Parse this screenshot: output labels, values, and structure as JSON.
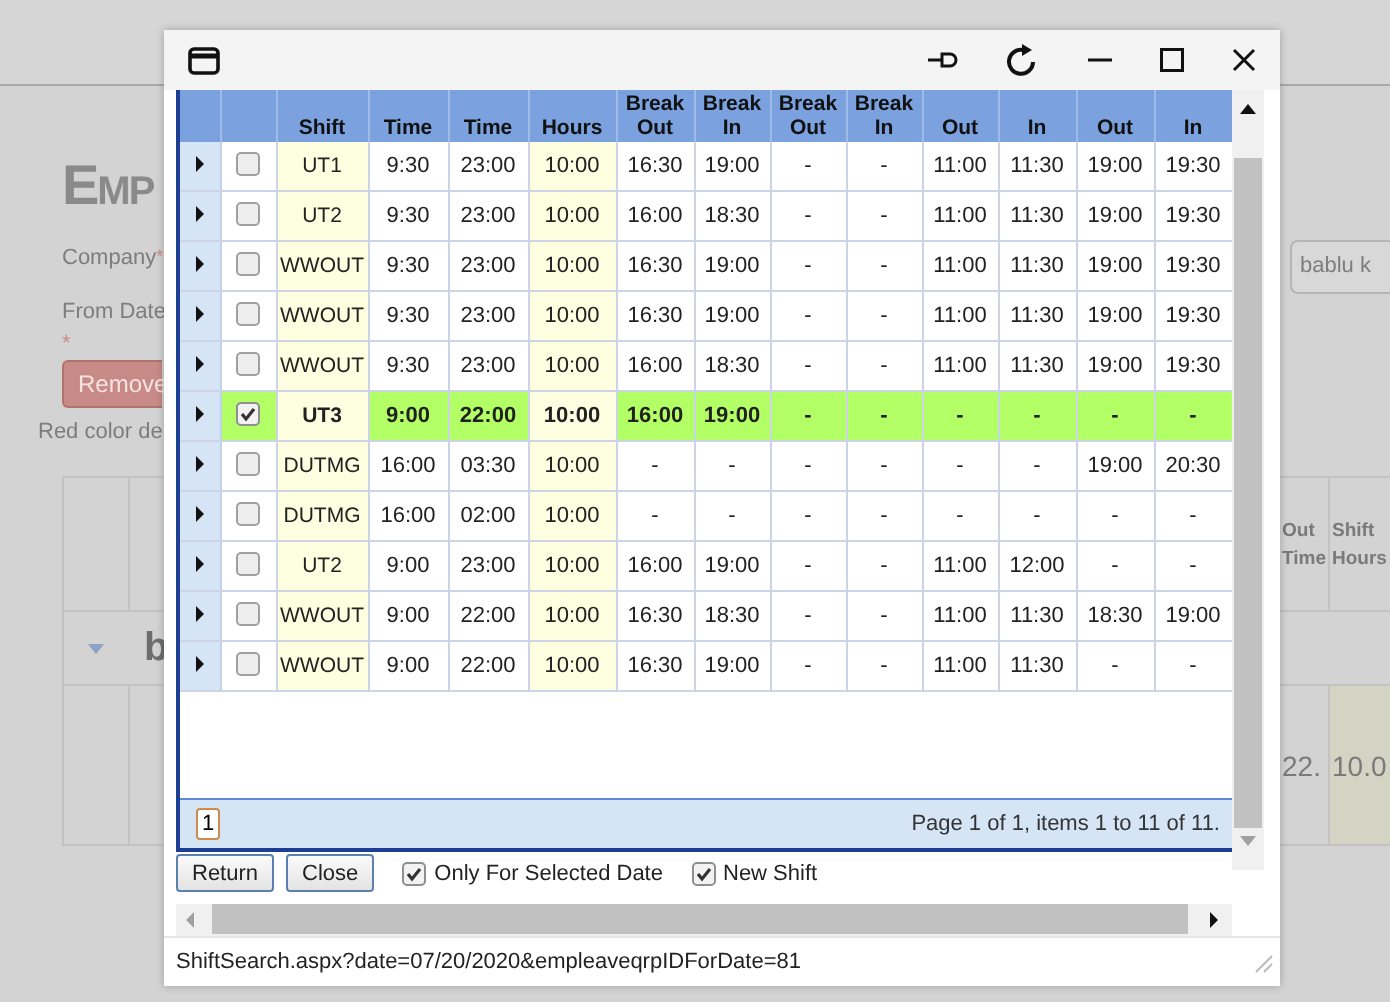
{
  "page": {
    "heading": "Emp",
    "company_label": "Company",
    "company_required": "*",
    "from_date_label": "From Date",
    "from_date_required": "*",
    "remove_button": "Remove",
    "note": "Red color de",
    "search_value": "bablu k",
    "columns": [
      "Out Time",
      "Shift Hours"
    ],
    "group_label": "b",
    "cells": [
      "22.",
      "10.0"
    ]
  },
  "dialog": {
    "columns": [
      "Shift",
      "Time",
      "Time",
      "Hours",
      "Break Out",
      "Break In",
      "Break Out",
      "Break In",
      "Out",
      "In",
      "Out",
      "In"
    ],
    "rows": [
      {
        "shift": "UT1",
        "values": [
          "9:30",
          "23:00",
          "10:00",
          "16:30",
          "19:00",
          "-",
          "-",
          "11:00",
          "11:30",
          "19:00",
          "19:30"
        ],
        "checked": false,
        "selected": false
      },
      {
        "shift": "UT2",
        "values": [
          "9:30",
          "23:00",
          "10:00",
          "16:00",
          "18:30",
          "-",
          "-",
          "11:00",
          "11:30",
          "19:00",
          "19:30"
        ],
        "checked": false,
        "selected": false
      },
      {
        "shift": "WWOUT",
        "values": [
          "9:30",
          "23:00",
          "10:00",
          "16:30",
          "19:00",
          "-",
          "-",
          "11:00",
          "11:30",
          "19:00",
          "19:30"
        ],
        "checked": false,
        "selected": false
      },
      {
        "shift": "WWOUT",
        "values": [
          "9:30",
          "23:00",
          "10:00",
          "16:30",
          "19:00",
          "-",
          "-",
          "11:00",
          "11:30",
          "19:00",
          "19:30"
        ],
        "checked": false,
        "selected": false
      },
      {
        "shift": "WWOUT",
        "values": [
          "9:30",
          "23:00",
          "10:00",
          "16:00",
          "18:30",
          "-",
          "-",
          "11:00",
          "11:30",
          "19:00",
          "19:30"
        ],
        "checked": false,
        "selected": false
      },
      {
        "shift": "UT3",
        "values": [
          "9:00",
          "22:00",
          "10:00",
          "16:00",
          "19:00",
          "-",
          "-",
          "-",
          "-",
          "-",
          "-"
        ],
        "checked": true,
        "selected": true
      },
      {
        "shift": "DUTMG",
        "values": [
          "16:00",
          "03:30",
          "10:00",
          "-",
          "-",
          "-",
          "-",
          "-",
          "-",
          "19:00",
          "20:30"
        ],
        "checked": false,
        "selected": false
      },
      {
        "shift": "DUTMG",
        "values": [
          "16:00",
          "02:00",
          "10:00",
          "-",
          "-",
          "-",
          "-",
          "-",
          "-",
          "-",
          "-"
        ],
        "checked": false,
        "selected": false
      },
      {
        "shift": "UT2",
        "values": [
          "9:00",
          "23:00",
          "10:00",
          "16:00",
          "19:00",
          "-",
          "-",
          "11:00",
          "12:00",
          "-",
          "-"
        ],
        "checked": false,
        "selected": false
      },
      {
        "shift": "WWOUT",
        "values": [
          "9:00",
          "22:00",
          "10:00",
          "16:30",
          "18:30",
          "-",
          "-",
          "11:00",
          "11:30",
          "18:30",
          "19:00"
        ],
        "checked": false,
        "selected": false
      },
      {
        "shift": "WWOUT",
        "values": [
          "9:00",
          "22:00",
          "10:00",
          "16:30",
          "19:00",
          "-",
          "-",
          "11:00",
          "11:30",
          "-",
          "-"
        ],
        "checked": false,
        "selected": false
      }
    ],
    "page_button": "1",
    "pager_info": "Page 1 of 1, items 1 to 11 of 11.",
    "buttons": [
      "Return",
      "Close"
    ],
    "options": [
      {
        "label": "Only For Selected Date",
        "checked": true
      },
      {
        "label": "New Shift",
        "checked": true
      }
    ],
    "status_url": "ShiftSearch.aspx?date=07/20/2020&empleaveqrpIDForDate=81"
  }
}
